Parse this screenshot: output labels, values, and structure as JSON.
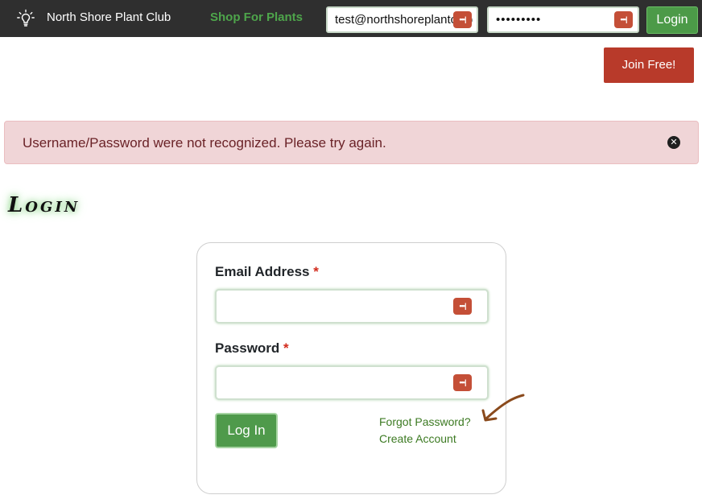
{
  "nav": {
    "brand": "North Shore Plant Club",
    "shop_link": "Shop For Plants",
    "email_value": "test@northshoreplantclub",
    "password_value": "•••••••••",
    "login_label": "Login",
    "password_key_glyph": "•••|",
    "icons": {
      "brand": "lightbulb-icon",
      "password_key": "password-manager-icon"
    }
  },
  "join": {
    "label": "Join Free!"
  },
  "alert": {
    "message": "Username/Password were not recognized. Please try again.",
    "close_glyph": "✕"
  },
  "page": {
    "heading": "Login"
  },
  "form": {
    "email_label": "Email Address",
    "password_label": "Password",
    "required_mark": "*",
    "email_value": "",
    "password_value": "",
    "submit_label": "Log In",
    "forgot_link": "Forgot Password?",
    "create_link": "Create Account"
  },
  "colors": {
    "nav_bg": "#2f2f2f",
    "brand_green": "#4ea54b",
    "button_green": "#4f9a4b",
    "join_red": "#b83a2a",
    "alert_bg": "#f0d5d7",
    "alert_text": "#6a2227",
    "link_green": "#3c7a22",
    "arrow_brown": "#8a4a1c"
  }
}
